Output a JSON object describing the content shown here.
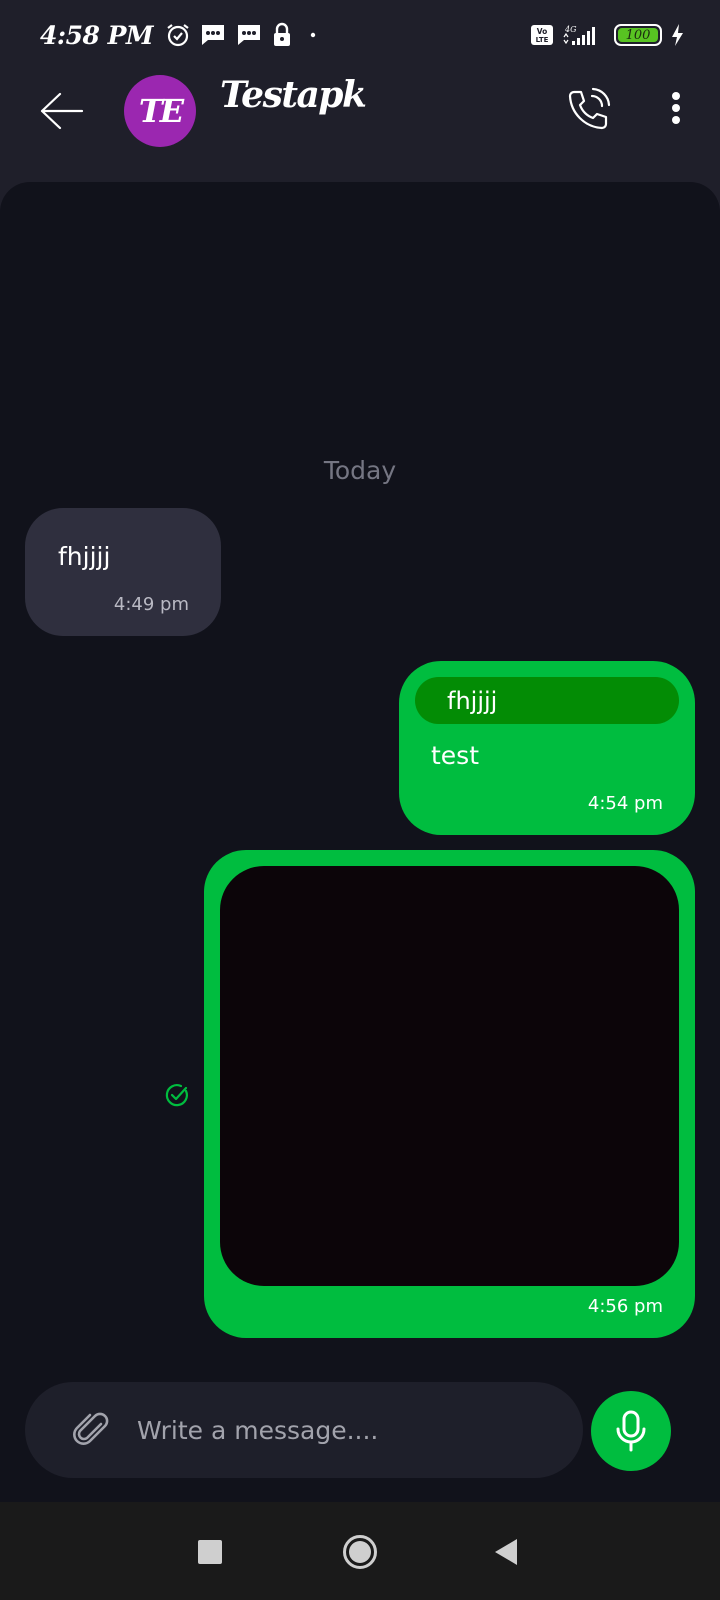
{
  "status_bar": {
    "time": "4:58 PM",
    "network": "4G",
    "volte": "Vo LTE",
    "battery_level": "100"
  },
  "header": {
    "avatar_initials": "TE",
    "contact_name": "Testapk"
  },
  "chat": {
    "date_separator": "Today",
    "messages": [
      {
        "direction": "incoming",
        "text": "fhjjjj",
        "time": "4:49 pm"
      },
      {
        "direction": "outgoing",
        "reply_to": "fhjjjj",
        "text": "test",
        "time": "4:54 pm"
      },
      {
        "direction": "outgoing",
        "type": "image",
        "time": "4:56 pm",
        "status": "read"
      }
    ]
  },
  "composer": {
    "placeholder": "Write a message...."
  },
  "icons": {
    "back": "arrow-left-icon",
    "call": "phone-icon",
    "more": "more-vertical-icon",
    "attach": "paperclip-icon",
    "mic": "microphone-icon",
    "read_receipt": "check-circle-icon"
  },
  "colors": {
    "accent": "#00bd3f",
    "reply_quote": "#038c05",
    "avatar": "#9b27b0",
    "incoming_bubble": "#2f2f3e",
    "chat_background": "#11121b",
    "header_background": "#1f1f2a"
  }
}
